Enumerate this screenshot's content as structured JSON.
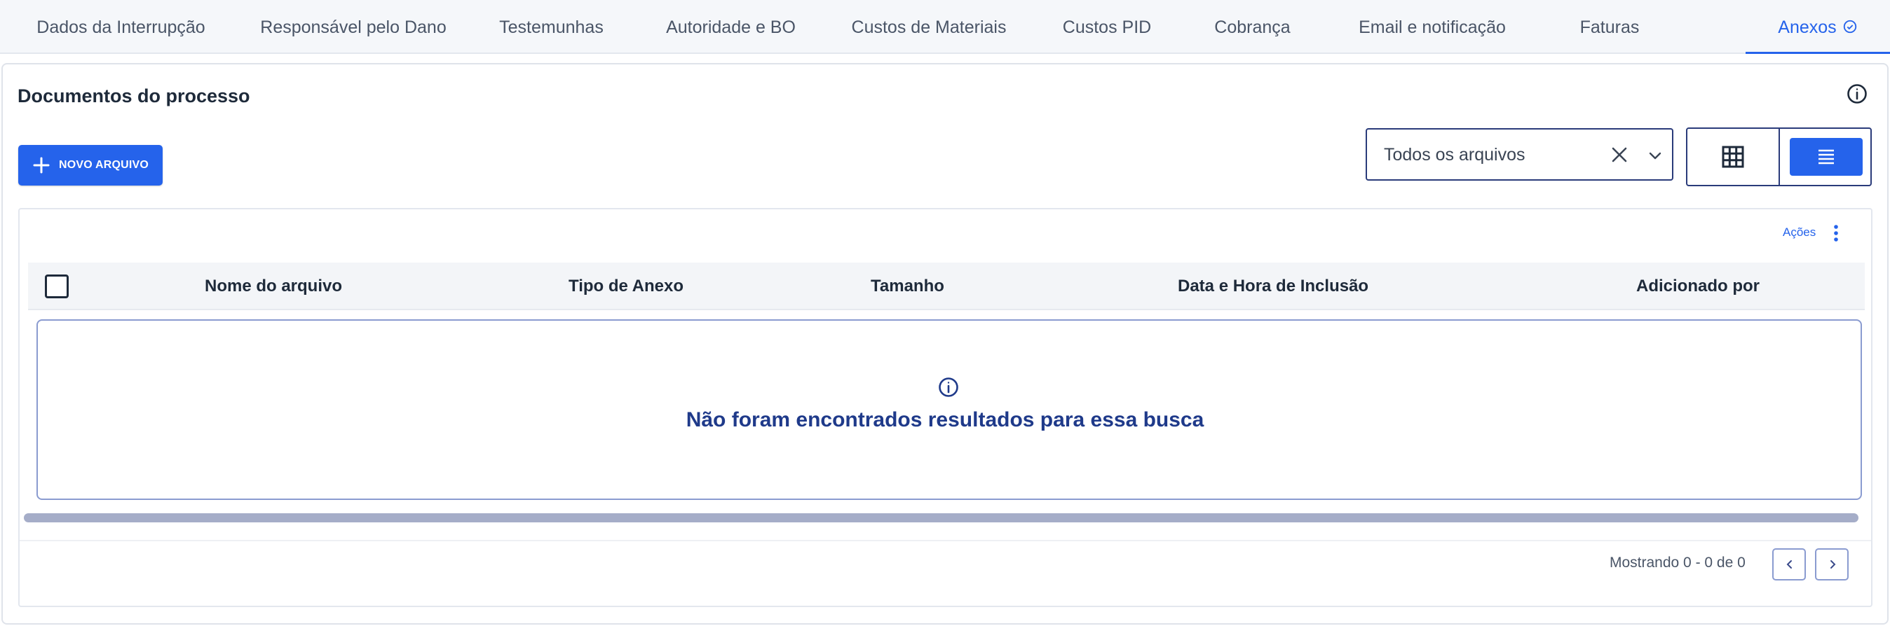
{
  "tabs": [
    {
      "label": "Dados da Interrupção"
    },
    {
      "label": "Responsável pelo Dano"
    },
    {
      "label": "Testemunhas"
    },
    {
      "label": "Autoridade e BO"
    },
    {
      "label": "Custos de Materiais"
    },
    {
      "label": "Custos PID"
    },
    {
      "label": "Cobrança"
    },
    {
      "label": "Email e notificação"
    },
    {
      "label": "Faturas"
    },
    {
      "label": "Anexos"
    }
  ],
  "active_tab": "Anexos",
  "section": {
    "title": "Documentos do processo",
    "new_button_label": "NOVO ARQUIVO"
  },
  "filter": {
    "selected": "Todos os arquivos"
  },
  "view_mode": "list",
  "table": {
    "actions_label": "Ações",
    "columns": [
      "Nome do arquivo",
      "Tipo de Anexo",
      "Tamanho",
      "Data e Hora de Inclusão",
      "Adicionado por"
    ],
    "rows": [],
    "empty_message": "Não foram encontrados resultados para essa busca"
  },
  "pagination": {
    "summary": "Mostrando 0 - 0 de 0"
  },
  "colors": {
    "accent": "#2563eb",
    "empty_text": "#1f3a8a",
    "border_dark": "#2a3b7a"
  },
  "icons": {
    "active_tab": "check-circle-icon",
    "info": "info-icon",
    "new_file": "plus-icon",
    "clear": "close-icon",
    "dropdown": "chevron-down-icon",
    "grid_view": "grid-icon",
    "list_view": "list-icon",
    "actions": "kebab-menu-icon",
    "prev": "chevron-left-icon",
    "next": "chevron-right-icon"
  }
}
